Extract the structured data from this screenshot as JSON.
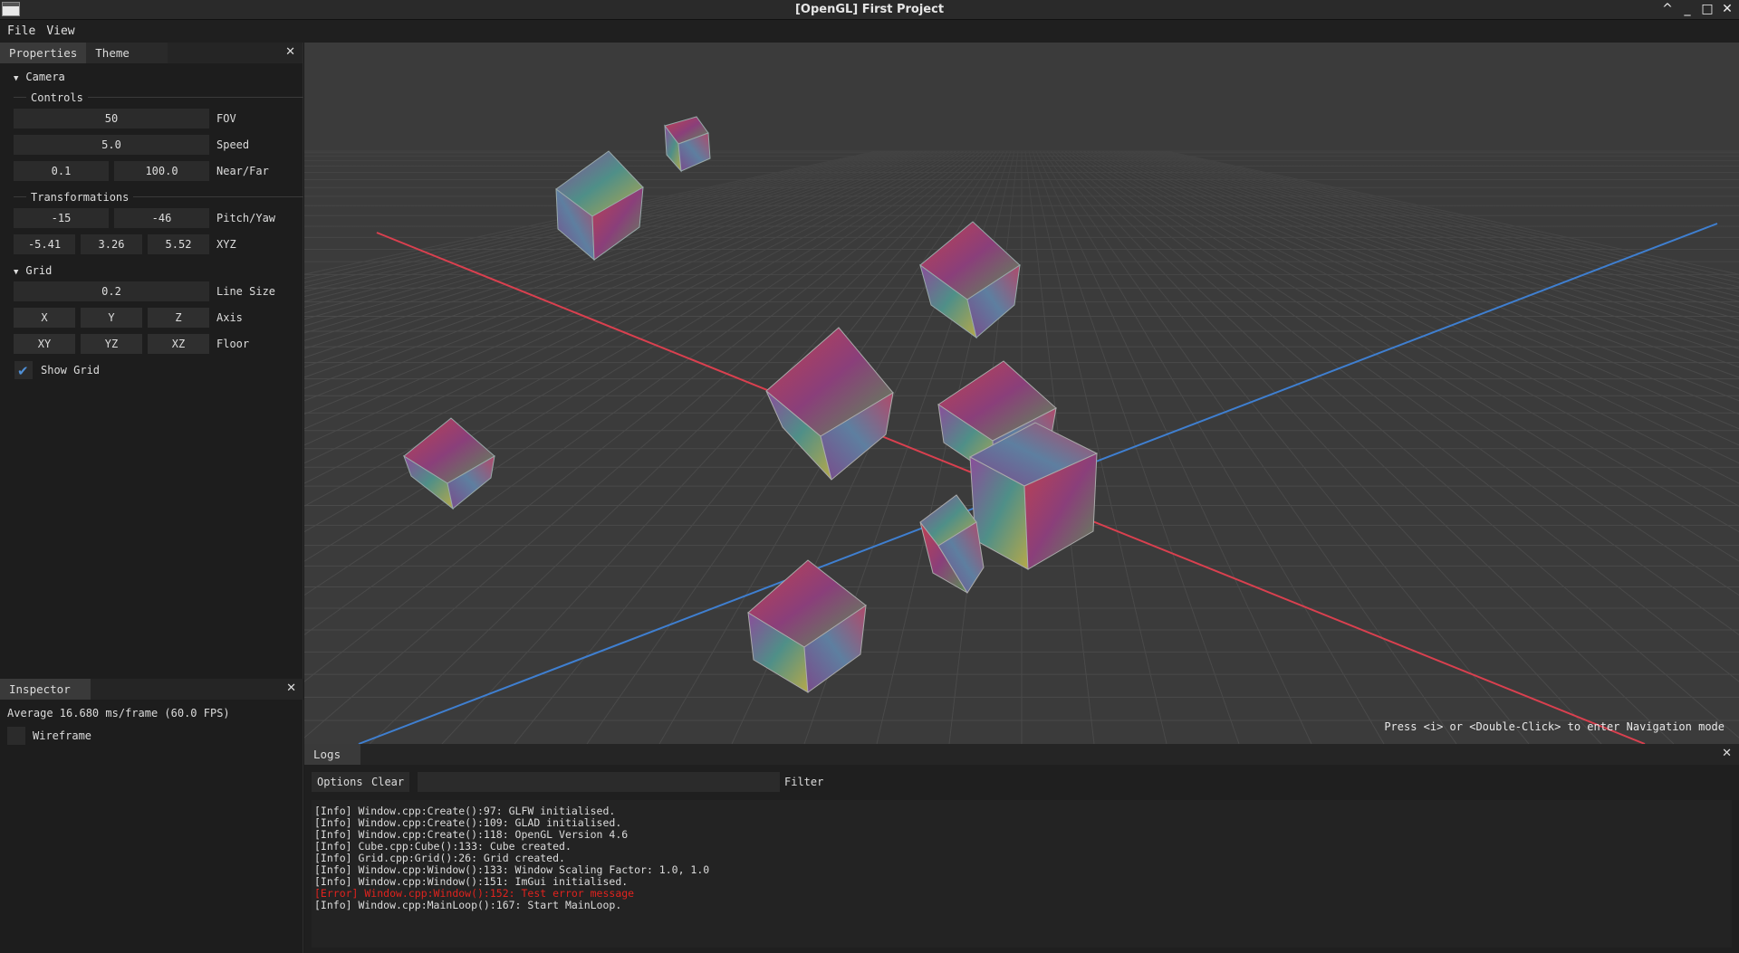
{
  "window": {
    "title": "[OpenGL] First Project",
    "controls": [
      "^",
      "_",
      "□",
      "✕"
    ]
  },
  "menu": {
    "items": [
      "File",
      "View"
    ]
  },
  "properties_panel": {
    "tabs": [
      "Properties",
      "Theme"
    ],
    "camera": {
      "header": "Camera",
      "controls_label": "Controls",
      "fov": {
        "value": "50",
        "label": "FOV"
      },
      "speed": {
        "value": "5.0",
        "label": "Speed"
      },
      "near_far": {
        "near": "0.1",
        "far": "100.0",
        "label": "Near/Far"
      },
      "transformations_label": "Transformations",
      "pitch_yaw": {
        "pitch": "-15",
        "yaw": "-46",
        "label": "Pitch/Yaw"
      },
      "xyz": {
        "x": "-5.41",
        "y": "3.26",
        "z": "5.52",
        "label": "XYZ"
      }
    },
    "grid": {
      "header": "Grid",
      "line_size": {
        "value": "0.2",
        "label": "Line Size"
      },
      "axis": {
        "buttons": [
          "X",
          "Y",
          "Z"
        ],
        "label": "Axis"
      },
      "floor": {
        "buttons": [
          "XY",
          "YZ",
          "XZ"
        ],
        "label": "Floor"
      },
      "show_grid": {
        "label": "Show Grid",
        "checked": true
      }
    }
  },
  "inspector": {
    "tab": "Inspector",
    "stats": "Average 16.680 ms/frame (60.0 FPS)",
    "wireframe": {
      "label": "Wireframe",
      "checked": false
    }
  },
  "viewport": {
    "hint": "Press <i> or <Double-Click> to enter Navigation mode",
    "colors": {
      "background": "#3b3b3b",
      "x_axis": "#d9404f",
      "z_axis": "#3f7fd0"
    }
  },
  "logs": {
    "tab": "Logs",
    "options_label": "Options",
    "clear_label": "Clear",
    "filter_label": "Filter",
    "lines": [
      {
        "text": "[Info] Window.cpp:Create():97: GLFW initialised.",
        "level": "info"
      },
      {
        "text": "[Info] Window.cpp:Create():109: GLAD initialised.",
        "level": "info"
      },
      {
        "text": "[Info] Window.cpp:Create():118: OpenGL Version 4.6",
        "level": "info"
      },
      {
        "text": "[Info] Cube.cpp:Cube():133: Cube created.",
        "level": "info"
      },
      {
        "text": "[Info] Grid.cpp:Grid():26: Grid created.",
        "level": "info"
      },
      {
        "text": "[Info] Window.cpp:Window():133: Window Scaling Factor: 1.0, 1.0",
        "level": "info"
      },
      {
        "text": "[Info] Window.cpp:Window():151: ImGui initialised.",
        "level": "info"
      },
      {
        "text": "[Error] Window.cpp:Window():152: Test error message",
        "level": "error"
      },
      {
        "text": "[Info] Window.cpp:MainLoop():167: Start MainLoop.",
        "level": "info"
      }
    ],
    "error_color": "#e0231e"
  }
}
